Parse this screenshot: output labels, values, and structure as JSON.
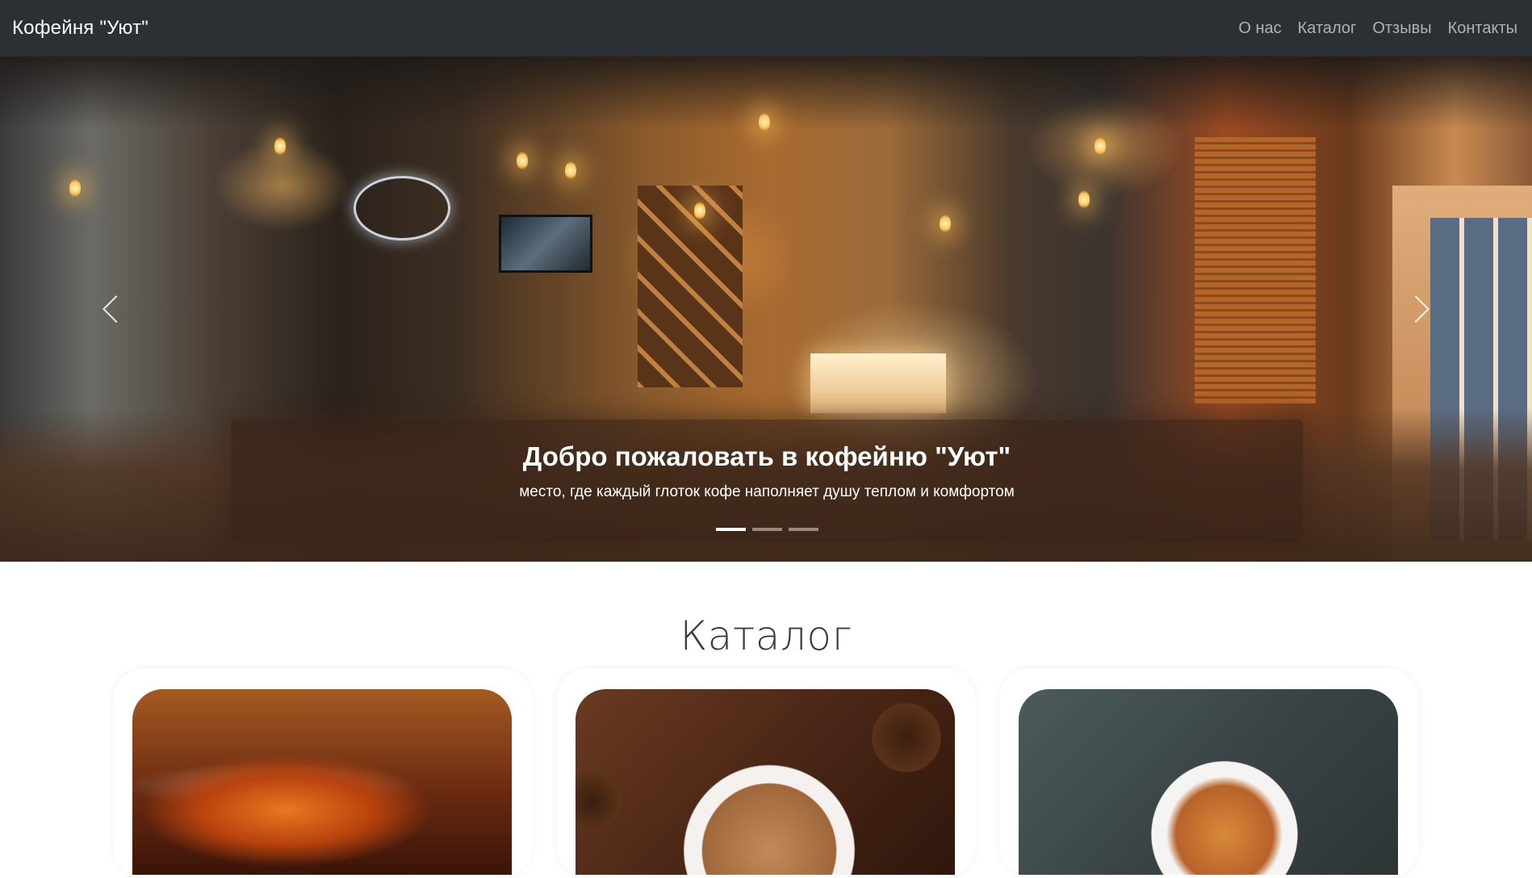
{
  "navbar": {
    "brand": "Кофейня \"Уют\"",
    "links": [
      "О нас",
      "Каталог",
      "Отзывы",
      "Контакты"
    ]
  },
  "hero": {
    "title": "Добро пожаловать в кофейню \"Уют\"",
    "subtitle": "место, где каждый глоток кофе наполняет душу теплом и комфортом",
    "slide_count": 3,
    "active_slide": 1,
    "prev_icon": "chevron-left-icon",
    "next_icon": "chevron-right-icon"
  },
  "catalog": {
    "title": "Каталог",
    "items": [
      {
        "image": "tea-cup-image"
      },
      {
        "image": "cappuccino-image"
      },
      {
        "image": "espresso-image"
      }
    ]
  },
  "colors": {
    "navbar_bg": "#2b3035",
    "nav_link": "rgba(255,255,255,0.62)",
    "caption_bg": "rgba(55,34,22,0.62)",
    "page_bg": "#ffffff"
  }
}
